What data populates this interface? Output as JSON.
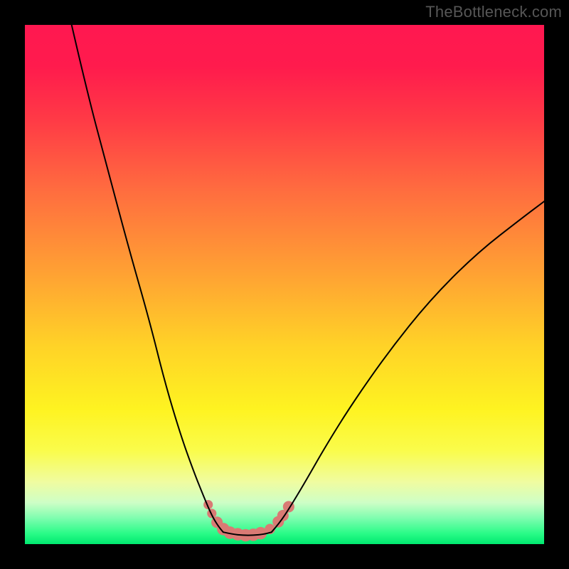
{
  "watermark": "TheBottleneck.com",
  "chart_data": {
    "type": "line",
    "title": "",
    "xlabel": "",
    "ylabel": "",
    "xlim": [
      0,
      100
    ],
    "ylim": [
      0,
      100
    ],
    "grid": false,
    "legend": false,
    "gradient_stops": [
      {
        "pct": 0,
        "color": "#ff1850"
      },
      {
        "pct": 8,
        "color": "#ff1b4d"
      },
      {
        "pct": 18,
        "color": "#ff3946"
      },
      {
        "pct": 32,
        "color": "#ff6d3f"
      },
      {
        "pct": 48,
        "color": "#ffa233"
      },
      {
        "pct": 62,
        "color": "#ffd327"
      },
      {
        "pct": 74,
        "color": "#fef321"
      },
      {
        "pct": 82,
        "color": "#fafc4b"
      },
      {
        "pct": 88,
        "color": "#f0fca0"
      },
      {
        "pct": 92,
        "color": "#cefec6"
      },
      {
        "pct": 95,
        "color": "#7efdaf"
      },
      {
        "pct": 98,
        "color": "#29fb87"
      },
      {
        "pct": 100,
        "color": "#00e970"
      }
    ],
    "series": [
      {
        "name": "left-branch",
        "x": [
          9,
          12,
          16,
          20,
          24,
          27,
          30,
          32.5,
          34.5,
          36,
          37.2,
          38.2
        ],
        "y": [
          100,
          87,
          72,
          57,
          43,
          31,
          21,
          14,
          9,
          5.5,
          3.5,
          2.3
        ]
      },
      {
        "name": "right-branch",
        "x": [
          47.5,
          49,
          51,
          54,
          58,
          63,
          70,
          78,
          87,
          96,
          100
        ],
        "y": [
          2.3,
          4,
          7,
          12,
          19,
          27,
          37,
          47,
          56,
          63,
          66
        ]
      },
      {
        "name": "bottom-flat",
        "x": [
          38.2,
          40,
          42,
          44,
          46,
          47.5
        ],
        "y": [
          2.3,
          1.9,
          1.7,
          1.7,
          1.9,
          2.3
        ]
      }
    ],
    "markers": [
      {
        "x": 35.3,
        "y": 7.6,
        "r": 0.9
      },
      {
        "x": 36.0,
        "y": 5.9,
        "r": 0.9
      },
      {
        "x": 37.0,
        "y": 4.2,
        "r": 1.1
      },
      {
        "x": 38.2,
        "y": 2.9,
        "r": 1.2
      },
      {
        "x": 39.5,
        "y": 2.2,
        "r": 1.2
      },
      {
        "x": 41.0,
        "y": 1.9,
        "r": 1.2
      },
      {
        "x": 42.5,
        "y": 1.7,
        "r": 1.2
      },
      {
        "x": 44.0,
        "y": 1.8,
        "r": 1.2
      },
      {
        "x": 45.4,
        "y": 2.1,
        "r": 1.2
      },
      {
        "x": 47.2,
        "y": 2.9,
        "r": 1.0
      },
      {
        "x": 48.8,
        "y": 4.3,
        "r": 1.1
      },
      {
        "x": 49.7,
        "y": 5.5,
        "r": 1.1
      },
      {
        "x": 50.8,
        "y": 7.2,
        "r": 1.1
      }
    ],
    "marker_color": "#d97a74",
    "curve_color": "#000000"
  }
}
